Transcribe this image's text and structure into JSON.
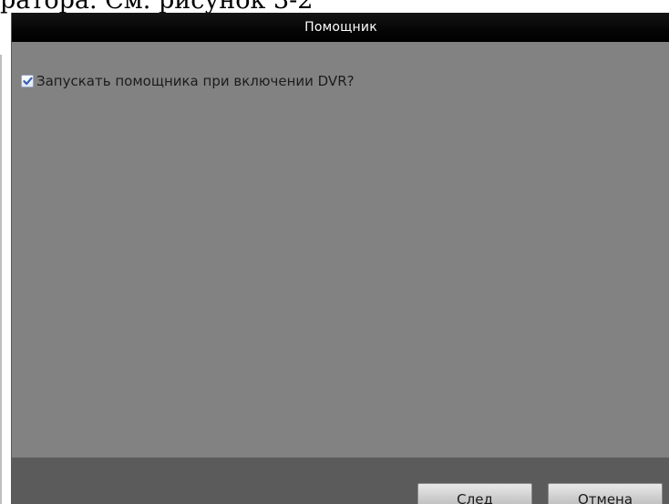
{
  "document": {
    "text": "ратора. См. рисунок 3-2"
  },
  "dialog": {
    "title": "Помощник",
    "option": {
      "label": "Запускать помощника при включении DVR?",
      "checked": true
    },
    "buttons": {
      "next_label": "След",
      "cancel_label": "Отмена"
    }
  }
}
